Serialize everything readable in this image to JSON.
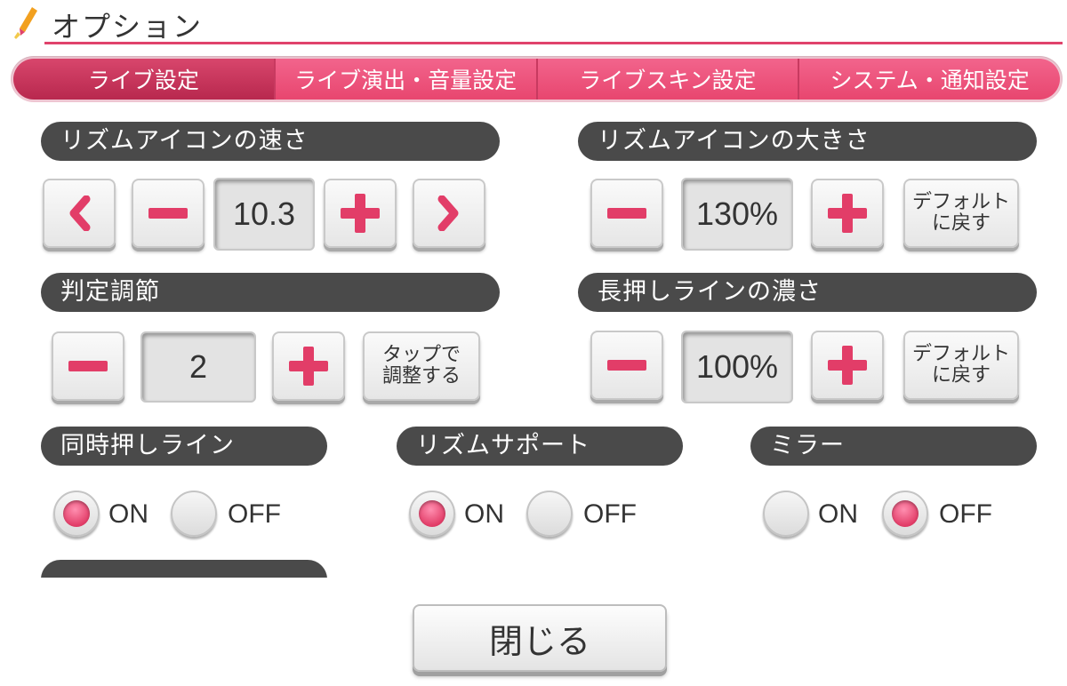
{
  "header": {
    "title": "オプション",
    "icon": "pencil-icon"
  },
  "tabs": [
    {
      "label": "ライブ設定",
      "active": true
    },
    {
      "label": "ライブ演出・音量設定",
      "active": false
    },
    {
      "label": "ライブスキン設定",
      "active": false
    },
    {
      "label": "システム・通知設定",
      "active": false
    }
  ],
  "rhythm_speed": {
    "title": "リズムアイコンの速さ",
    "value": "10.3"
  },
  "rhythm_size": {
    "title": "リズムアイコンの大きさ",
    "value": "130%",
    "default_label": "デフォルト\nに戻す"
  },
  "timing": {
    "title": "判定調節",
    "value": "2",
    "tap_label": "タップで\n調整する"
  },
  "long_line": {
    "title": "長押しラインの濃さ",
    "value": "100%",
    "default_label": "デフォルト\nに戻す"
  },
  "simul_line": {
    "title": "同時押しライン",
    "on_label": "ON",
    "off_label": "OFF",
    "selected": "ON"
  },
  "rhythm_support": {
    "title": "リズムサポート",
    "on_label": "ON",
    "off_label": "OFF",
    "selected": "ON"
  },
  "mirror": {
    "title": "ミラー",
    "on_label": "ON",
    "off_label": "OFF",
    "selected": "OFF"
  },
  "close": {
    "label": "閉じる"
  },
  "colors": {
    "accent": "#e0436c",
    "tab": "#f2648c",
    "tab_active": "#b8284e",
    "pill": "#4a4a4a"
  }
}
